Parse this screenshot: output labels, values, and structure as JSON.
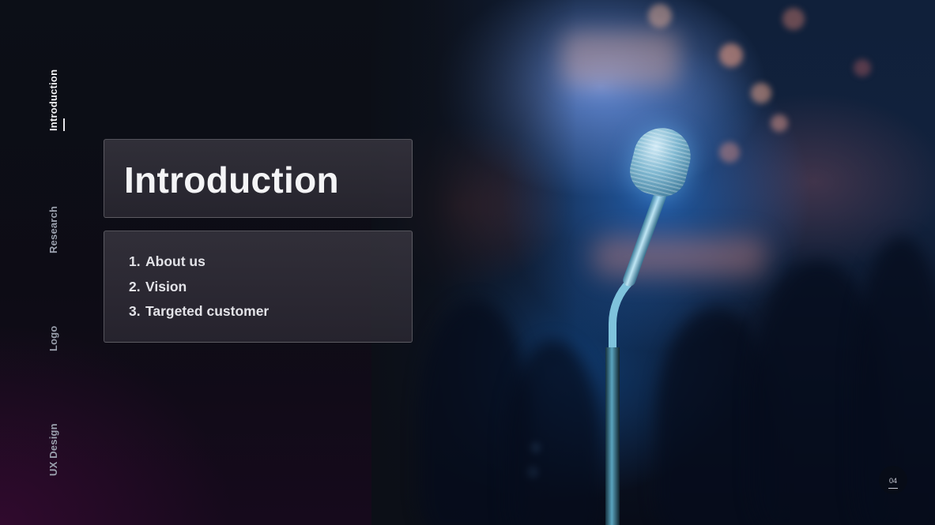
{
  "nav": {
    "items": [
      {
        "label": "Introduction",
        "active": true
      },
      {
        "label": "Research",
        "active": false
      },
      {
        "label": "Logo",
        "active": false
      },
      {
        "label": "UX Design",
        "active": false
      }
    ]
  },
  "slide": {
    "title": "Introduction",
    "list": [
      {
        "num": "1.",
        "text": "About us"
      },
      {
        "num": "2.",
        "text": "Vision"
      },
      {
        "num": "3.",
        "text": "Targeted customer"
      }
    ],
    "page_number": "04"
  },
  "colors": {
    "background": "#0c0f17",
    "card": "#35333d",
    "text": "#f4f4f6",
    "nav_inactive": "#9aa0ad",
    "mic_highlight": "#7fc3dc"
  }
}
